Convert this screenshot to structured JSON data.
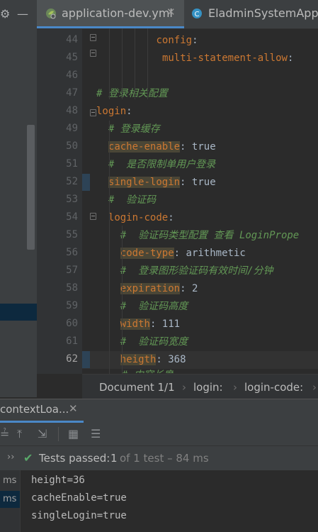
{
  "tabs": [
    {
      "label": "application-dev.yml",
      "active": true,
      "icon": "yaml-spring-icon"
    },
    {
      "label": "EladminSystemApplic",
      "active": false,
      "icon": "class-c-icon"
    }
  ],
  "editor": {
    "current_line": 62,
    "lines": [
      {
        "n": 44,
        "indent": 10,
        "tokens": [
          {
            "t": "config",
            "c": "k"
          },
          {
            "t": ":",
            "c": "v"
          }
        ]
      },
      {
        "n": 45,
        "indent": 11,
        "tokens": [
          {
            "t": "multi-statement-allow",
            "c": "k"
          },
          {
            "t": ":",
            "c": "v"
          }
        ]
      },
      {
        "n": 46,
        "indent": 0,
        "tokens": []
      },
      {
        "n": 47,
        "indent": 0,
        "tokens": [
          {
            "t": "# 登录相关配置",
            "c": "c"
          }
        ]
      },
      {
        "n": 48,
        "indent": 0,
        "tokens": [
          {
            "t": "login",
            "c": "k"
          },
          {
            "t": ":",
            "c": "v"
          }
        ]
      },
      {
        "n": 49,
        "indent": 2,
        "tokens": [
          {
            "t": "# 登录缓存",
            "c": "c"
          }
        ]
      },
      {
        "n": 50,
        "indent": 2,
        "tokens": [
          {
            "t": "cache-enable",
            "c": "kh"
          },
          {
            "t": ": true",
            "c": "v"
          }
        ]
      },
      {
        "n": 51,
        "indent": 2,
        "tokens": [
          {
            "t": "#  是否限制单用户登录",
            "c": "c"
          }
        ]
      },
      {
        "n": 52,
        "indent": 2,
        "tokens": [
          {
            "t": "single-login",
            "c": "kh"
          },
          {
            "t": ": true",
            "c": "v"
          }
        ]
      },
      {
        "n": 53,
        "indent": 2,
        "tokens": [
          {
            "t": "#  验证码",
            "c": "c"
          }
        ]
      },
      {
        "n": 54,
        "indent": 2,
        "tokens": [
          {
            "t": "login-code",
            "c": "k"
          },
          {
            "t": ":",
            "c": "v"
          }
        ]
      },
      {
        "n": 55,
        "indent": 4,
        "tokens": [
          {
            "t": "#  验证码类型配置 查看 LoginPrope",
            "c": "c"
          }
        ]
      },
      {
        "n": 56,
        "indent": 4,
        "tokens": [
          {
            "t": "code-type",
            "c": "kh"
          },
          {
            "t": ": arithmetic",
            "c": "v"
          }
        ]
      },
      {
        "n": 57,
        "indent": 4,
        "tokens": [
          {
            "t": "#  登录图形验证码有效时间/分钟",
            "c": "c"
          }
        ]
      },
      {
        "n": 58,
        "indent": 4,
        "tokens": [
          {
            "t": "expiration",
            "c": "kh"
          },
          {
            "t": ": 2",
            "c": "v"
          }
        ]
      },
      {
        "n": 59,
        "indent": 4,
        "tokens": [
          {
            "t": "#  验证码高度",
            "c": "c"
          }
        ]
      },
      {
        "n": 60,
        "indent": 4,
        "tokens": [
          {
            "t": "width",
            "c": "kh"
          },
          {
            "t": ": 111",
            "c": "v"
          }
        ]
      },
      {
        "n": 61,
        "indent": 4,
        "tokens": [
          {
            "t": "#  验证码宽度",
            "c": "c"
          }
        ]
      },
      {
        "n": 62,
        "indent": 4,
        "tokens": [
          {
            "t": "heigth",
            "c": "kh"
          },
          {
            "t": ": 368",
            "c": "v"
          }
        ]
      }
    ],
    "partial_last_line": "# 内容长度"
  },
  "breadcrumb": {
    "items": [
      "Document 1/1",
      "login:",
      "login-code:"
    ]
  },
  "run_panel": {
    "tab_label": "contextLoa...",
    "status_prefix": "Tests passed: ",
    "status_count": "1",
    "status_suffix": " of 1 test – 84 ms",
    "gutter_labels": [
      "ms",
      "ms"
    ],
    "output": [
      "height=36",
      "cacheEnable=true",
      "singleLogin=true"
    ]
  },
  "colors": {
    "accent": "#4a88c7",
    "key": "#cc7832",
    "comment": "#629755",
    "pass": "#59a869"
  }
}
